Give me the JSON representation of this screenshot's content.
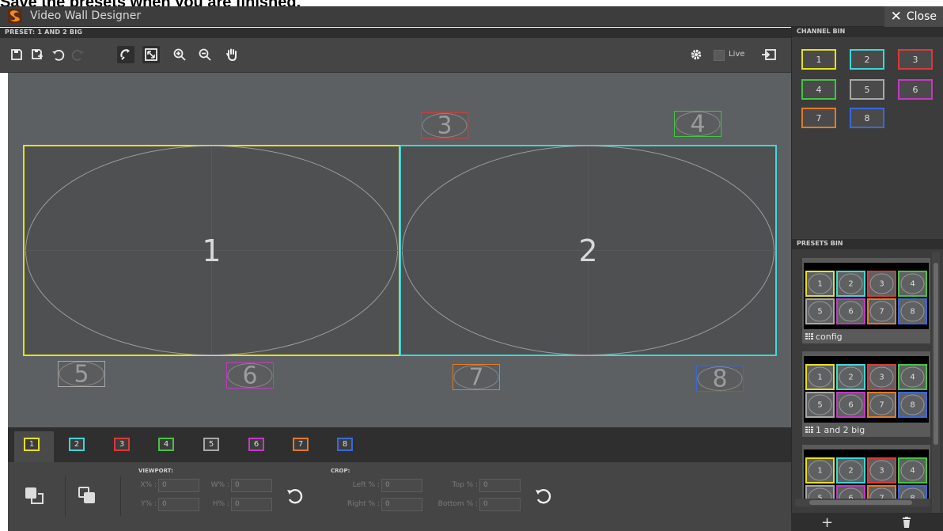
{
  "caption": "Save the presets when you are finished.",
  "window": {
    "title": "Video Wall Designer",
    "close_label": "Close"
  },
  "preset": {
    "label": "PRESET:  1 AND 2 BIG"
  },
  "toolbar": {
    "live_label": "Live"
  },
  "channels": [
    {
      "num": "1",
      "color": "#e6e020"
    },
    {
      "num": "2",
      "color": "#3fd6d6"
    },
    {
      "num": "3",
      "color": "#d93a3a"
    },
    {
      "num": "4",
      "color": "#44c444"
    },
    {
      "num": "5",
      "color": "#a8a8a8"
    },
    {
      "num": "6",
      "color": "#c23ac2"
    },
    {
      "num": "7",
      "color": "#e07a2a"
    },
    {
      "num": "8",
      "color": "#3a68d8"
    }
  ],
  "canvas_slots": [
    "1",
    "2",
    "3",
    "4",
    "5",
    "6",
    "7",
    "8"
  ],
  "viewport": {
    "label": "VIEWPORT:",
    "x_label": "X% :",
    "x_value": "0",
    "y_label": "Y% :",
    "y_value": "0",
    "w_label": "W% :",
    "w_value": "0",
    "h_label": "H% :",
    "h_value": "0"
  },
  "crop": {
    "label": "CROP:",
    "left_label": "Left % :",
    "left_value": "0",
    "right_label": "Right % :",
    "right_value": "0",
    "top_label": "Top % :",
    "top_value": "0",
    "bottom_label": "Bottom % :",
    "bottom_value": "0"
  },
  "channel_bin": {
    "title": "CHANNEL BIN"
  },
  "presets_bin": {
    "title": "PRESETS BIN",
    "presets": [
      {
        "name": "config"
      },
      {
        "name": "1 and 2 big"
      },
      {
        "name": ""
      }
    ]
  }
}
